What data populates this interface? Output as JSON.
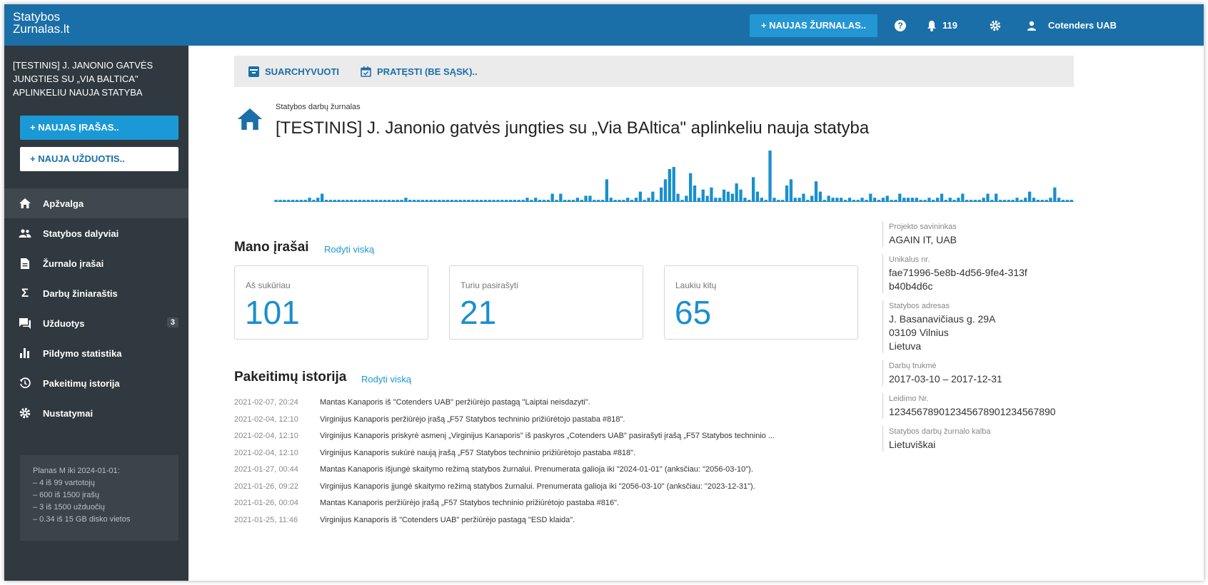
{
  "app": {
    "logo_line1": "Statybos",
    "logo_line2": "Zurnalas.lt"
  },
  "topbar": {
    "new_journal": "NAUJAS ŽURNALAS..",
    "notifications_count": "119",
    "user": "Cotenders UAB"
  },
  "sidebar": {
    "project_title": "[TESTINIS] J. JANONIO GATVĖS JUNGTIES SU „VIA BALTICA\" APLINKELIU NAUJA STATYBA",
    "new_entry": "NAUJAS ĮRAŠAS..",
    "new_task": "NAUJA UŽDUOTIS..",
    "items": [
      {
        "label": "Apžvalga",
        "icon": "home-icon"
      },
      {
        "label": "Statybos dalyviai",
        "icon": "people-icon"
      },
      {
        "label": "Žurnalo įrašai",
        "icon": "document-icon"
      },
      {
        "label": "Darbų žiniaraštis",
        "icon": "sigma-icon"
      },
      {
        "label": "Užduotys",
        "icon": "chat-icon",
        "badge": "3"
      },
      {
        "label": "Pildymo statistika",
        "icon": "bar-chart-icon"
      },
      {
        "label": "Pakeitimų istorija",
        "icon": "history-icon"
      },
      {
        "label": "Nustatymai",
        "icon": "gear-icon"
      }
    ],
    "plan": {
      "title": "Planas M iki 2024-01-01:",
      "lines": [
        "– 4 iš 99 vartotojų",
        "– 600 iš 1500 įrašų",
        "– 3 iš 1500 užduočių",
        "– 0.34 iš 15 GB disko vietos"
      ]
    }
  },
  "toolbar": {
    "archive": "SUARCHYVUOTI",
    "extend": "PRATĘSTI (BE SĄSK).."
  },
  "page": {
    "subtitle": "Statybos darbų žurnalas",
    "title": "[TESTINIS] J. Janonio gatvės jungties su „Via BAltica\" aplinkeliu nauja statyba"
  },
  "activity": {
    "values": [
      1,
      1,
      1,
      1,
      1,
      1,
      1,
      1,
      2,
      1,
      2,
      4,
      1,
      1,
      1,
      1,
      1,
      1,
      1,
      1,
      1,
      1,
      1,
      1,
      1,
      1,
      1,
      1,
      1,
      1,
      1,
      2,
      1,
      1,
      1,
      1,
      1,
      1,
      1,
      1,
      1,
      1,
      1,
      1,
      1,
      1,
      1,
      1,
      1,
      1,
      1,
      1,
      1,
      1,
      1,
      1,
      1,
      1,
      1,
      1,
      2,
      1,
      2,
      1,
      1,
      1,
      4,
      1,
      4,
      1,
      1,
      1,
      2,
      1,
      3,
      3,
      1,
      1,
      1,
      11,
      2,
      1,
      1,
      1,
      2,
      1,
      2,
      5,
      1,
      2,
      5,
      1,
      7,
      11,
      16,
      17,
      4,
      1,
      3,
      14,
      8,
      2,
      6,
      3,
      7,
      2,
      2,
      6,
      5,
      4,
      9,
      6,
      2,
      1,
      12,
      5,
      2,
      1,
      25,
      2,
      1,
      1,
      8,
      11,
      2,
      2,
      4,
      1,
      3,
      10,
      5,
      1,
      3,
      2,
      2,
      2,
      1,
      2,
      1,
      1,
      2,
      1,
      4,
      2,
      1,
      2,
      3,
      1,
      1,
      4,
      2,
      2,
      2,
      2,
      1,
      1,
      2,
      1,
      2,
      4,
      1,
      2,
      1,
      2,
      4,
      1,
      1,
      1,
      1,
      2,
      4,
      1,
      4,
      1,
      1,
      1,
      1,
      2,
      1,
      2,
      5,
      2,
      1,
      1,
      1,
      2,
      7,
      2,
      1,
      1,
      1
    ],
    "max": 25
  },
  "my_entries": {
    "title": "Mano įrašai",
    "link": "Rodyti viską",
    "cards": [
      {
        "label": "Aš sukūriau",
        "value": "101"
      },
      {
        "label": "Turiu pasirašyti",
        "value": "21"
      },
      {
        "label": "Laukiu kitų",
        "value": "65"
      }
    ]
  },
  "history": {
    "title": "Pakeitimų istorija",
    "link": "Rodyti viską",
    "rows": [
      {
        "time": "2021-02-07, 20:24",
        "text": "Mantas Kanaporis iš \"Cotenders UAB\" peržiūrėjo pastagą \"Laiptai neisdazyti\"."
      },
      {
        "time": "2021-02-04, 12:10",
        "text": "Virginijus Kanaporis peržiūrėjo įrašą „F57 Statybos techninio prižiūrėtojo pastaba #818\"."
      },
      {
        "time": "2021-02-04, 12:10",
        "text": "Virginijus Kanaporis priskyrė asmenį „Virginijus Kanaporis\" iš paskyros „Cotenders UAB\" pasirašyti įrašą „F57 Statybos techninio ..."
      },
      {
        "time": "2021-02-04, 12:10",
        "text": "Virginijus Kanaporis sukūrė naują įrašą „F57 Statybos techninio prižiūrėtojo pastaba #818\"."
      },
      {
        "time": "2021-01-27, 00:44",
        "text": "Mantas Kanaporis išjungė skaitymo režimą statybos žurnalui. Prenumerata galioja iki \"2024-01-01\" (anksčiau: \"2056-03-10\")."
      },
      {
        "time": "2021-01-26, 09:22",
        "text": "Virginijus Kanaporis įjungė skaitymo režimą statybos žurnalui. Prenumerata galioja iki \"2056-03-10\" (anksčiau: \"2023-12-31\")."
      },
      {
        "time": "2021-01-26, 00:04",
        "text": "Mantas Kanaporis peržiūrėjo įrašą „F57 Statybos techninio prižiūrėtojo pastaba #816\"."
      },
      {
        "time": "2021-01-25, 11:46",
        "text": "Virginijus Kanaporis iš \"Cotenders UAB\" peržiūrėjo pastagą \"ESD klaida\"."
      }
    ]
  },
  "info": [
    {
      "label": "Projekto savininkas",
      "value": "AGAIN IT, UAB"
    },
    {
      "label": "Unikalus nr.",
      "value": "fae71996-5e8b-4d56-9fe4-313fb40b4d6c"
    },
    {
      "label": "Statybos adresas",
      "value": "J. Basanavičiaus g. 29A\n03109 Vilnius\nLietuva"
    },
    {
      "label": "Darbų trukmė",
      "value": "2017-03-10 – 2017-12-31"
    },
    {
      "label": "Leidimo Nr.",
      "value": "123456789012345678901234567890"
    },
    {
      "label": "Statybos darbų žurnalo kalba",
      "value": "Lietuviškai"
    }
  ],
  "colors": {
    "topbar": "#1b6fa8",
    "accent": "#1a99d6",
    "sidebar": "#30393f"
  }
}
